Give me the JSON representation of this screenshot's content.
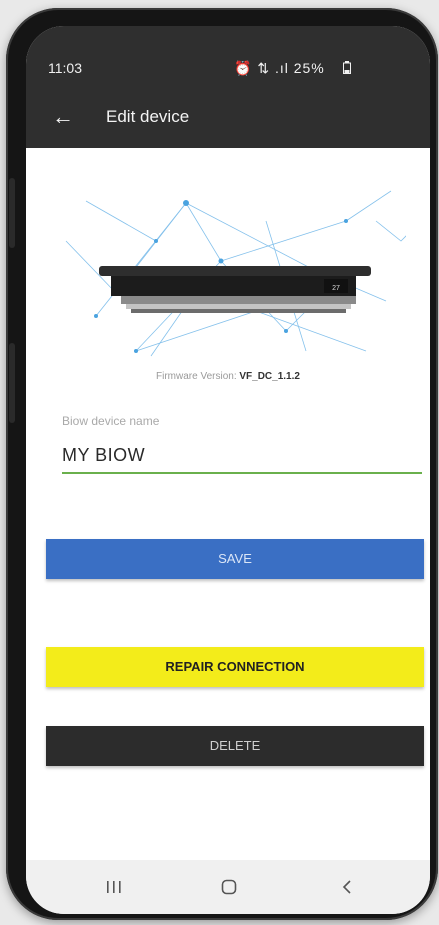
{
  "status_bar": {
    "time": "11:03",
    "icons": "⏰ ⇅ .ıl 25%",
    "battery_icon": "battery-icon"
  },
  "app_bar": {
    "back_icon": "back-arrow-icon",
    "title": "Edit device"
  },
  "device": {
    "display_value": "27"
  },
  "firmware": {
    "label": "Firmware Version:",
    "value": "VF_DC_1.1.2"
  },
  "form": {
    "name_label": "Biow device name",
    "name_value": "MY BIOW"
  },
  "buttons": {
    "save": "SAVE",
    "repair": "REPAIR CONNECTION",
    "delete": "DELETE"
  },
  "nav_bar": {
    "recents_icon": "recents-icon",
    "home_icon": "home-icon",
    "back_icon": "nav-back-icon"
  },
  "colors": {
    "appbar": "#2f2f2f",
    "save": "#3a6fc4",
    "repair": "#f3ec1a",
    "delete": "#2c2c2c",
    "underline": "#6ab04c"
  }
}
